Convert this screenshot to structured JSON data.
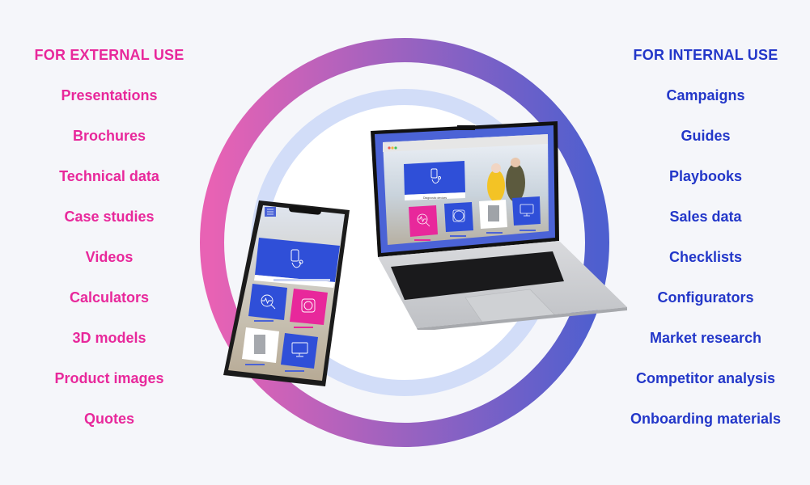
{
  "external": {
    "heading": "FOR EXTERNAL USE",
    "items": [
      "Presentations",
      "Brochures",
      "Technical data",
      "Case studies",
      "Videos",
      "Calculators",
      "3D models",
      "Product images",
      "Quotes"
    ]
  },
  "internal": {
    "heading": "FOR INTERNAL USE",
    "items": [
      "Campaigns",
      "Guides",
      "Playbooks",
      "Sales data",
      "Checklists",
      "Configurators",
      "Market research",
      "Competitor analysis",
      "Onboarding materials"
    ]
  },
  "laptop_screen": {
    "hero_caption": "Diagnostic devices"
  },
  "colors": {
    "external_accent": "#e8289b",
    "internal_accent": "#2337c9",
    "ring_start": "#e660b3",
    "ring_end": "#4f5fcf",
    "inner_ring": "#d2ddf8",
    "tile_blue": "#2f4fd8",
    "tile_pink": "#e8289b"
  }
}
